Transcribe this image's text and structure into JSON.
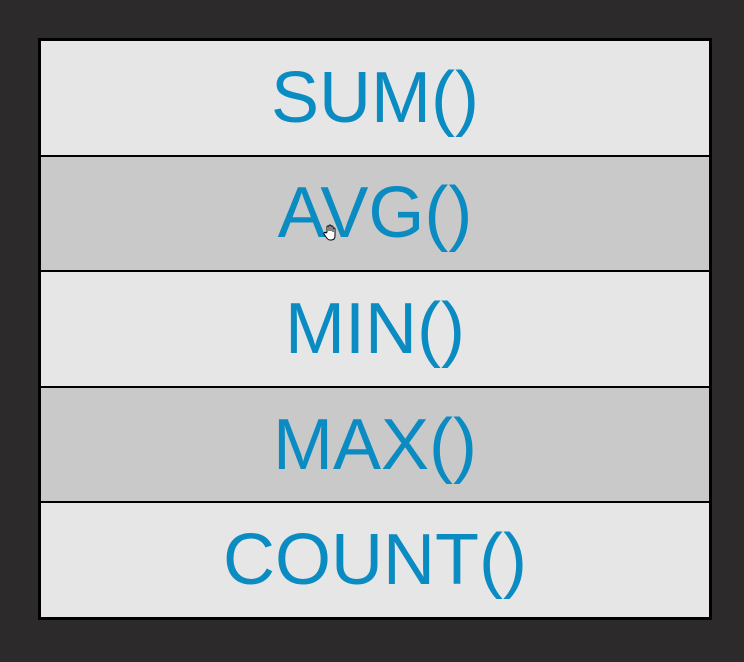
{
  "functions": [
    {
      "label": "SUM()"
    },
    {
      "label": "AVG()"
    },
    {
      "label": "MIN()"
    },
    {
      "label": "MAX()"
    },
    {
      "label": "COUNT()"
    }
  ],
  "colors": {
    "text": "#0a8bc2",
    "row_light": "#e6e6e6",
    "row_dark": "#c9c9c9",
    "background": "#2c2a2a"
  }
}
